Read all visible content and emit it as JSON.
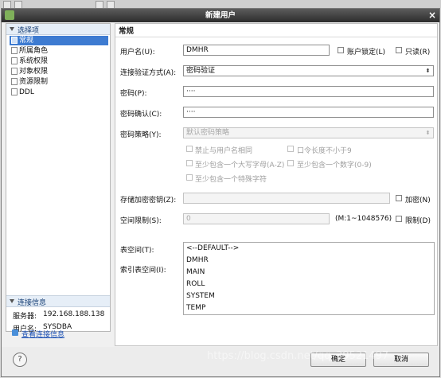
{
  "dialog": {
    "title": "新建用户",
    "close_glyph": "×"
  },
  "nav": {
    "header": "选择项",
    "items": [
      {
        "label": "常规",
        "selected": true
      },
      {
        "label": "所属角色"
      },
      {
        "label": "系统权限"
      },
      {
        "label": "对象权限"
      },
      {
        "label": "资源限制"
      },
      {
        "label": "DDL"
      }
    ],
    "connection": {
      "header": "连接信息",
      "server_label": "服务器:",
      "server_value": "192.168.188.138",
      "user_label": "用户名:",
      "user_value": "SYSDBA",
      "view_link": "查看连接信息"
    }
  },
  "form": {
    "section_title": "常规",
    "username_label": "用户名(U):",
    "username_value": "DMHR",
    "account_locked_label": "账户锁定(L)",
    "readonly_label": "只读(R)",
    "auth_label": "连接验证方式(A):",
    "auth_value": "密码验证",
    "password_label": "密码(P):",
    "password_value": "····",
    "confirm_label": "密码确认(C):",
    "confirm_value": "····",
    "policy_label": "密码策略(Y):",
    "policy_value": "默认密码策略",
    "policy_options": {
      "no_same_as_user": "禁止与用户名相同",
      "min_length": "口令长度不小于9",
      "upper_lower": "至少包含一个大写字母(A-Z)",
      "digit": "至少包含一个数字(0-9)",
      "special": "至少包含一个特殊字符"
    },
    "storage_key_label": "存储加密密钥(Z):",
    "encrypt_label": "加密(N)",
    "space_limit_label": "空间限制(S):",
    "space_limit_value": "0",
    "space_limit_range": "(M:1~1048576)",
    "limit_label": "限制(D)",
    "tablespace_label": "表空间(T):",
    "index_tablespace_label": "索引表空间(I):",
    "tablespaces": [
      "<--DEFAULT-->",
      "DMHR",
      "MAIN",
      "ROLL",
      "SYSTEM",
      "TEMP"
    ]
  },
  "buttons": {
    "ok": "确定",
    "cancel": "取消",
    "help_glyph": "?"
  },
  "icons": {
    "close": "close-icon",
    "help": "help-icon",
    "dropdown": "chevron-down-icon"
  },
  "colors": {
    "title_bar": "#3a3a3a",
    "selection": "#3d7bd1",
    "link": "#1a4fb4"
  },
  "watermark": "https://blog.csdn.net/qq_39521497"
}
